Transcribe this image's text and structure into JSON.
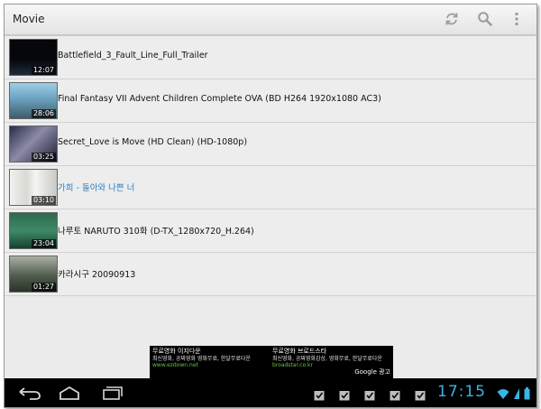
{
  "app": {
    "title": "Movie",
    "actions": [
      {
        "name": "sync-icon"
      },
      {
        "name": "search-icon"
      },
      {
        "name": "overflow-menu-icon"
      }
    ]
  },
  "videos": [
    {
      "title": "Battlefield_3_Fault_Line_Full_Trailer",
      "duration": "12:07",
      "thumb_colors": [
        "#05070b",
        "#1e2a3a"
      ],
      "active": false
    },
    {
      "title": "Final Fantasy VII Advent Children Complete OVA (BD H264 1920x1080 AC3)",
      "duration": "28:06",
      "thumb_colors": [
        "#6fa7c4",
        "#3f5b6a"
      ],
      "active": false
    },
    {
      "title": "Secret_Love is Move (HD Clean) (HD-1080p)",
      "duration": "03:25",
      "thumb_colors": [
        "#2a2d44",
        "#8c8aa8"
      ],
      "active": false
    },
    {
      "title": "가희 - 돌아와 나쁜 너",
      "duration": "03:10",
      "thumb_colors": [
        "#f1f1ef",
        "#c7c9c3"
      ],
      "active": true
    },
    {
      "title": "나루토 NARUTO 310화 (D-TX_1280x720_H.264)",
      "duration": "23:04",
      "thumb_colors": [
        "#2e6a4e",
        "#174030"
      ],
      "active": false
    },
    {
      "title": "카라시구 20090913",
      "duration": "01:27",
      "thumb_colors": [
        "#4f5c4c",
        "#a9b0a4"
      ],
      "active": false
    }
  ],
  "ad": {
    "items": [
      {
        "title": "무료영화 이지다운",
        "desc": "최신영화, 공짜영화 영화무료, 한달무료다운",
        "url": "www.ezdown.net"
      },
      {
        "title": "무료영화 브로드스타",
        "desc": "최신영화, 공짜영화감상, 영화무료, 한달무료다운",
        "url": "broadstar.co.kr"
      }
    ],
    "tag": "Google 광고"
  },
  "system_bar": {
    "nav": [
      {
        "name": "back-icon"
      },
      {
        "name": "home-icon"
      },
      {
        "name": "recent-apps-icon"
      }
    ],
    "notification_count": 5,
    "clock": "17:15",
    "colors": {
      "accent": "#39b4e6"
    }
  }
}
